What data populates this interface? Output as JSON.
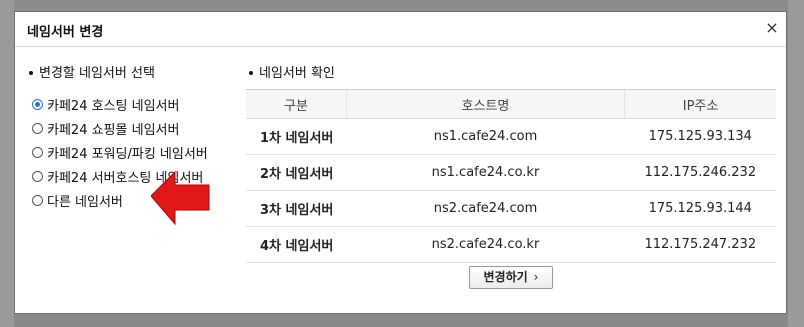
{
  "dialog": {
    "title": "네임서버 변경",
    "close_symbol": "×"
  },
  "left_section": {
    "title": "변경할 네임서버 선택",
    "options": [
      {
        "label": "카페24 호스팅 네임서버",
        "checked": true
      },
      {
        "label": "카페24 쇼핑몰 네임서버",
        "checked": false
      },
      {
        "label": "카페24 포워딩/파킹 네임서버",
        "checked": false
      },
      {
        "label": "카페24 서버호스팅 네임서버",
        "checked": false
      },
      {
        "label": "다른 네임서버",
        "checked": false
      }
    ]
  },
  "right_section": {
    "title": "네임서버 확인",
    "columns": [
      "구분",
      "호스트명",
      "IP주소"
    ],
    "rows": [
      {
        "label": "1차 네임서버",
        "host": "ns1.cafe24.com",
        "ip": "175.125.93.134"
      },
      {
        "label": "2차 네임서버",
        "host": "ns1.cafe24.co.kr",
        "ip": "112.175.246.232"
      },
      {
        "label": "3차 네임서버",
        "host": "ns2.cafe24.com",
        "ip": "175.125.93.144"
      },
      {
        "label": "4차 네임서버",
        "host": "ns2.cafe24.co.kr",
        "ip": "112.175.247.232"
      }
    ]
  },
  "actions": {
    "change_label": "변경하기",
    "change_chevron": "›"
  },
  "colors": {
    "arrow": "#e01818",
    "radio_checked": "#2a6fd6",
    "overlay": "#8c8c8c"
  }
}
